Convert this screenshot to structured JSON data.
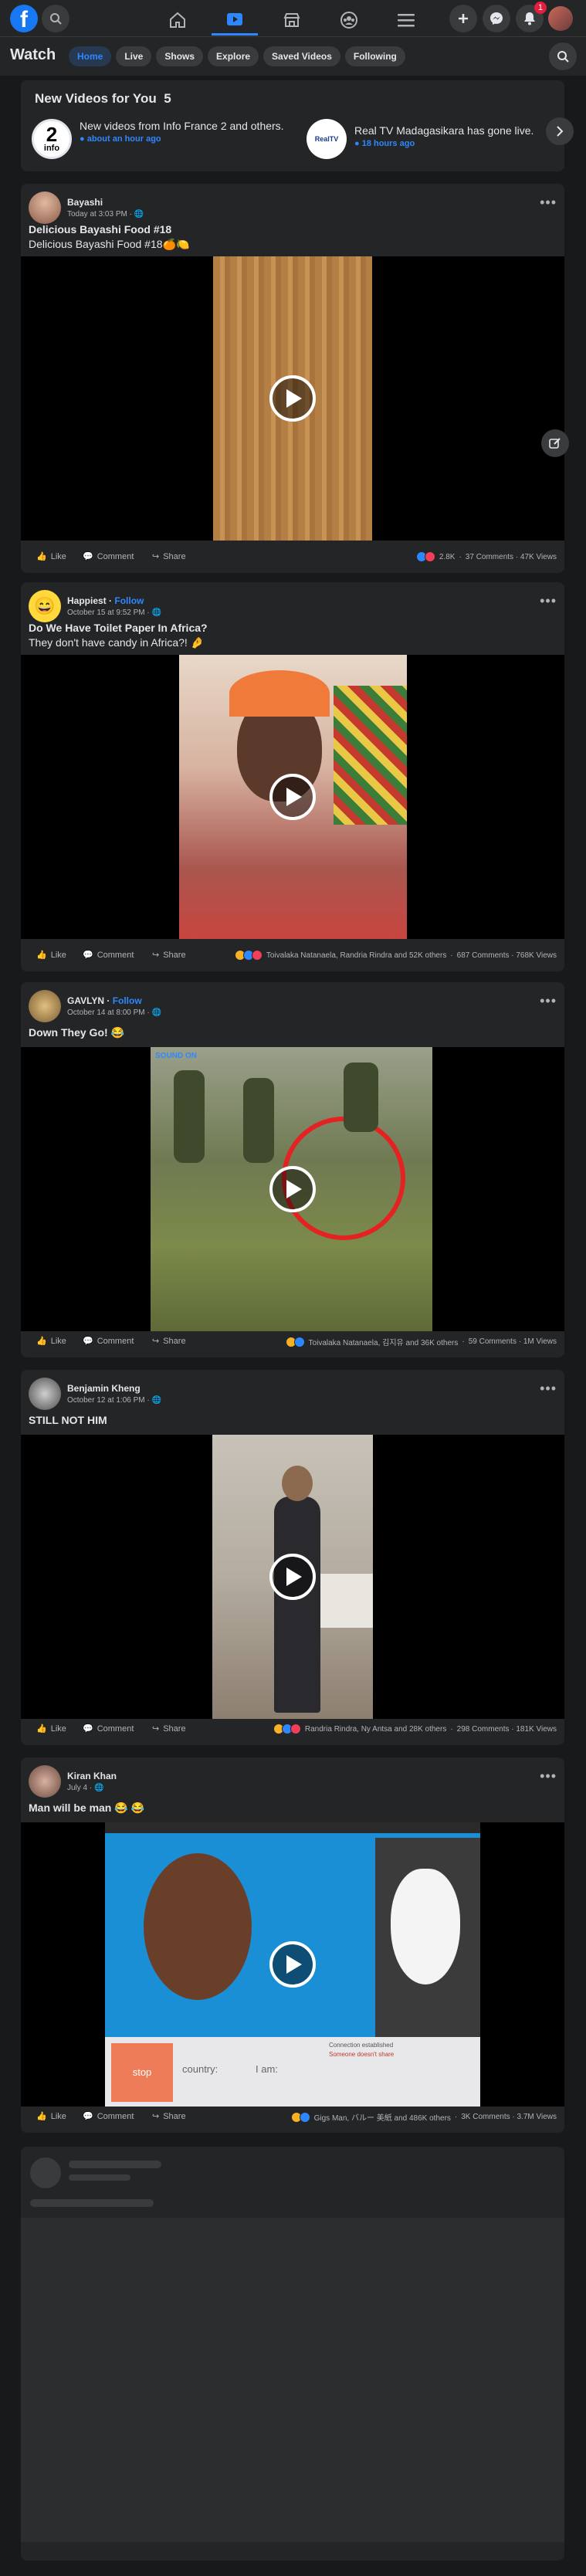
{
  "topbar": {
    "logo": "f",
    "icons": [
      "search-icon",
      "home-icon",
      "watch-icon",
      "marketplace-icon",
      "groups-icon",
      "menu-icon",
      "create-icon",
      "messenger-icon",
      "notifications-icon"
    ],
    "notifications_count": "1"
  },
  "watch": {
    "title": "Watch",
    "tabs": [
      {
        "label": "Home",
        "active": true
      },
      {
        "label": "Live",
        "active": false
      },
      {
        "label": "Shows",
        "active": false
      },
      {
        "label": "Explore",
        "active": false
      },
      {
        "label": "Saved Videos",
        "active": false
      },
      {
        "label": "Following",
        "active": false
      }
    ]
  },
  "new_videos": {
    "title": "New Videos for You",
    "count": "5",
    "items": [
      {
        "logo": "2",
        "logo_sub": "info",
        "text": "New videos from Info France 2 and others.",
        "time": "about an hour ago"
      },
      {
        "logo": "RealTV",
        "text": "Real TV Madagasikara has gone live.",
        "time": "18 hours ago"
      }
    ]
  },
  "posts": [
    {
      "author": "Bayashi",
      "follow": "",
      "time": "Today at 3:03 PM",
      "title": "Delicious Bayashi Food #18",
      "text": "Delicious Bayashi Food #18🍊🍋",
      "stats_reactions": "2.8K",
      "stats": "37 Comments · 47K Views"
    },
    {
      "author": "Happiest",
      "follow": "Follow",
      "time": "October 15 at 9:52 PM",
      "title": "Do We Have Toilet Paper In Africa?",
      "text": "They don't have candy in Africa?! 🤌",
      "stats_reactions": "Toivalaka Natanaela, Randria Rindra and 52K others",
      "stats": "687 Comments · 768K Views"
    },
    {
      "author": "GAVLYN",
      "follow": "Follow",
      "time": "October 14 at 8:00 PM",
      "title": "Down They Go! 😂",
      "text": "",
      "stats_reactions": "Toivalaka Natanaela, 김지유 and 36K others",
      "stats": "59 Comments · 1M Views"
    },
    {
      "author": "Benjamin Kheng",
      "follow": "",
      "time": "October 12 at 1:06 PM",
      "title": "STILL NOT HIM",
      "text": "",
      "stats_reactions": "Randria Rindra, Ny Antsa and 28K others",
      "stats": "298 Comments · 181K Views"
    },
    {
      "author": "Kiran Khan",
      "follow": "",
      "time": "July 4",
      "title": "Man will be man 😂 😂",
      "text": "",
      "stats_reactions": "Gigs Man, バルー 美紙 and 486K others",
      "stats": "3K Comments · 3.7M Views"
    }
  ],
  "actions": {
    "like": "Like",
    "comment": "Comment",
    "share": "Share"
  },
  "video_overlays": {
    "news_label": "SOUND ON",
    "chat_stop": "stop",
    "chat_country": "country:",
    "chat_iam": "I am:",
    "chat_status": "Connection established",
    "chat_status_sub": "Someone doesn't share"
  },
  "colors": {
    "accent": "#2d88ff",
    "bg": "#18191a",
    "card": "#242526",
    "badge": "#e41e3f"
  }
}
